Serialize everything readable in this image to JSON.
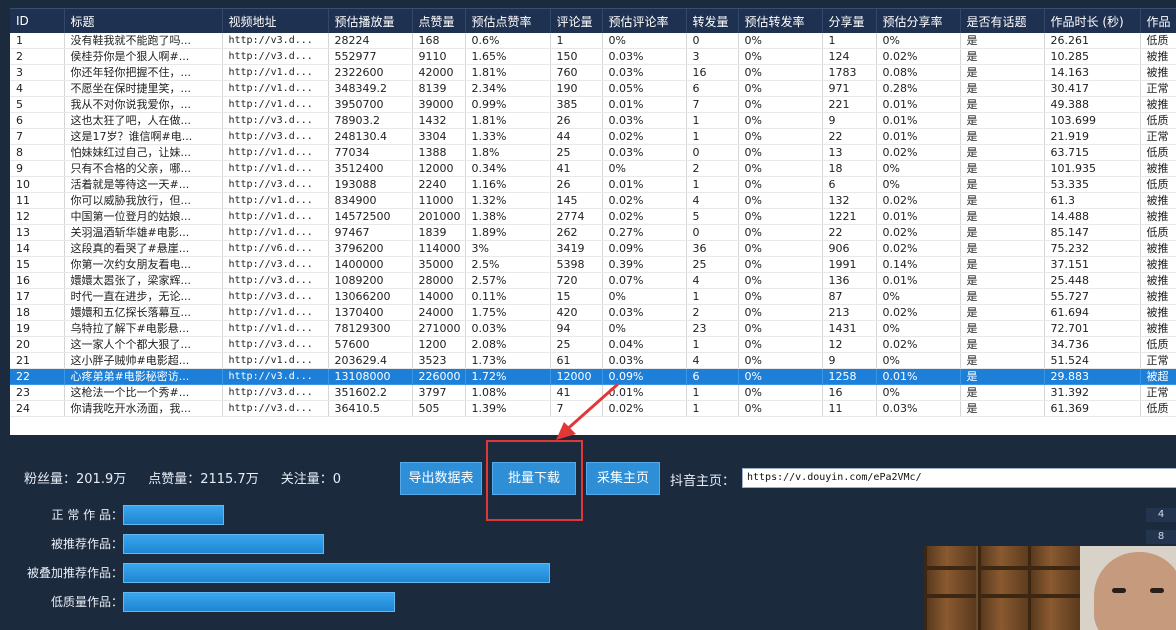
{
  "table": {
    "columns": [
      "ID",
      "标题",
      "视频地址",
      "预估播放量",
      "点赞量",
      "预估点赞率",
      "评论量",
      "预估评论率",
      "转发量",
      "预估转发率",
      "分享量",
      "预估分享率",
      "是否有话题",
      "作品时长 (秒)",
      "作品"
    ],
    "rows": [
      [
        "1",
        "没有鞋我就不能跑了吗...",
        "http://v3.d...",
        "28224",
        "168",
        "0.6%",
        "1",
        "0%",
        "0",
        "0%",
        "1",
        "0%",
        "是",
        "26.261",
        "低质"
      ],
      [
        "2",
        "侯桂芬你是个狠人啊#...",
        "http://v3.d...",
        "552977",
        "9110",
        "1.65%",
        "150",
        "0.03%",
        "3",
        "0%",
        "124",
        "0.02%",
        "是",
        "10.285",
        "被推"
      ],
      [
        "3",
        "你还年轻你把握不住，...",
        "http://v1.d...",
        "2322600",
        "42000",
        "1.81%",
        "760",
        "0.03%",
        "16",
        "0%",
        "1783",
        "0.08%",
        "是",
        "14.163",
        "被推"
      ],
      [
        "4",
        "不愿坐在保时捷里笑，...",
        "http://v1.d...",
        "348349.2",
        "8139",
        "2.34%",
        "190",
        "0.05%",
        "6",
        "0%",
        "971",
        "0.28%",
        "是",
        "30.417",
        "正常"
      ],
      [
        "5",
        "我从不对你说我爱你，...",
        "http://v1.d...",
        "3950700",
        "39000",
        "0.99%",
        "385",
        "0.01%",
        "7",
        "0%",
        "221",
        "0.01%",
        "是",
        "49.388",
        "被推"
      ],
      [
        "6",
        "这也太狂了吧，人在做...",
        "http://v3.d...",
        "78903.2",
        "1432",
        "1.81%",
        "26",
        "0.03%",
        "1",
        "0%",
        "9",
        "0.01%",
        "是",
        "103.699",
        "低质"
      ],
      [
        "7",
        "这是17岁？谁信啊#电...",
        "http://v3.d...",
        "248130.4",
        "3304",
        "1.33%",
        "44",
        "0.02%",
        "1",
        "0%",
        "22",
        "0.01%",
        "是",
        "21.919",
        "正常"
      ],
      [
        "8",
        "怕妹妹红过自己，让妹...",
        "http://v1.d...",
        "77034",
        "1388",
        "1.8%",
        "25",
        "0.03%",
        "0",
        "0%",
        "13",
        "0.02%",
        "是",
        "63.715",
        "低质"
      ],
      [
        "9",
        "只有不合格的父亲，哪...",
        "http://v1.d...",
        "3512400",
        "12000",
        "0.34%",
        "41",
        "0%",
        "2",
        "0%",
        "18",
        "0%",
        "是",
        "101.935",
        "被推"
      ],
      [
        "10",
        "活着就是等待这一天#...",
        "http://v3.d...",
        "193088",
        "2240",
        "1.16%",
        "26",
        "0.01%",
        "1",
        "0%",
        "6",
        "0%",
        "是",
        "53.335",
        "低质"
      ],
      [
        "11",
        "你可以威胁我放行，但...",
        "http://v1.d...",
        "834900",
        "11000",
        "1.32%",
        "145",
        "0.02%",
        "4",
        "0%",
        "132",
        "0.02%",
        "是",
        "61.3",
        "被推"
      ],
      [
        "12",
        "中国第一位登月的姑娘...",
        "http://v1.d...",
        "14572500",
        "201000",
        "1.38%",
        "2774",
        "0.02%",
        "5",
        "0%",
        "1221",
        "0.01%",
        "是",
        "14.488",
        "被推"
      ],
      [
        "13",
        "关羽温酒斩华雄#电影...",
        "http://v1.d...",
        "97467",
        "1839",
        "1.89%",
        "262",
        "0.27%",
        "0",
        "0%",
        "22",
        "0.02%",
        "是",
        "85.147",
        "低质"
      ],
      [
        "14",
        "这段真的看哭了#悬崖...",
        "http://v6.d...",
        "3796200",
        "114000",
        "3%",
        "3419",
        "0.09%",
        "36",
        "0%",
        "906",
        "0.02%",
        "是",
        "75.232",
        "被推"
      ],
      [
        "15",
        "你第一次约女朋友看电...",
        "http://v3.d...",
        "1400000",
        "35000",
        "2.5%",
        "5398",
        "0.39%",
        "25",
        "0%",
        "1991",
        "0.14%",
        "是",
        "37.151",
        "被推"
      ],
      [
        "16",
        "嬛嬛太嚣张了，梁家辉...",
        "http://v3.d...",
        "1089200",
        "28000",
        "2.57%",
        "720",
        "0.07%",
        "4",
        "0%",
        "136",
        "0.01%",
        "是",
        "25.448",
        "被推"
      ],
      [
        "17",
        "时代一直在进步，无论...",
        "http://v3.d...",
        "13066200",
        "14000",
        "0.11%",
        "15",
        "0%",
        "1",
        "0%",
        "87",
        "0%",
        "是",
        "55.727",
        "被推"
      ],
      [
        "18",
        "嬛嬛和五亿探长落幕互...",
        "http://v1.d...",
        "1370400",
        "24000",
        "1.75%",
        "420",
        "0.03%",
        "2",
        "0%",
        "213",
        "0.02%",
        "是",
        "61.694",
        "被推"
      ],
      [
        "19",
        "乌特拉了解下#电影悬...",
        "http://v1.d...",
        "78129300",
        "271000",
        "0.03%",
        "94",
        "0%",
        "23",
        "0%",
        "1431",
        "0%",
        "是",
        "72.701",
        "被推"
      ],
      [
        "20",
        "这一家人个个都大狠了...",
        "http://v3.d...",
        "57600",
        "1200",
        "2.08%",
        "25",
        "0.04%",
        "1",
        "0%",
        "12",
        "0.02%",
        "是",
        "34.736",
        "低质"
      ],
      [
        "21",
        "这小胖子贼帅#电影超...",
        "http://v1.d...",
        "203629.4",
        "3523",
        "1.73%",
        "61",
        "0.03%",
        "4",
        "0%",
        "9",
        "0%",
        "是",
        "51.524",
        "正常"
      ],
      [
        "22",
        "心疼弟弟#电影秘密访...",
        "http://v3.d...",
        "13108000",
        "226000",
        "1.72%",
        "12000",
        "0.09%",
        "6",
        "0%",
        "1258",
        "0.01%",
        "是",
        "29.883",
        "被超"
      ],
      [
        "23",
        "这枪法一个比一个秀#...",
        "http://v3.d...",
        "351602.2",
        "3797",
        "1.08%",
        "41",
        "0.01%",
        "1",
        "0%",
        "16",
        "0%",
        "是",
        "31.392",
        "正常"
      ],
      [
        "24",
        "你请我吃开水汤面，我...",
        "http://v3.d...",
        "36410.5",
        "505",
        "1.39%",
        "7",
        "0.02%",
        "1",
        "0%",
        "11",
        "0.03%",
        "是",
        "61.369",
        "低质"
      ]
    ]
  },
  "stats": {
    "fans": "粉丝量：201.9万",
    "likes": "点赞量：2115.7万",
    "follows": "关注量：0"
  },
  "buttons": {
    "export": "导出数据表",
    "batch_download": "批量下载",
    "collect": "采集主页"
  },
  "douyin": {
    "label": "抖音主页：",
    "url": "https://v.douyin.com/ePa2VMc/"
  },
  "bars": [
    {
      "label": "正 常 作 品：",
      "share": 0.188
    },
    {
      "label": "被推荐作品：",
      "share": 0.376
    },
    {
      "label": "被叠加推荐作品：",
      "share": 0.798
    },
    {
      "label": "低质量作品：",
      "share": 0.508
    }
  ],
  "side_numbers": [
    "4",
    "8"
  ]
}
